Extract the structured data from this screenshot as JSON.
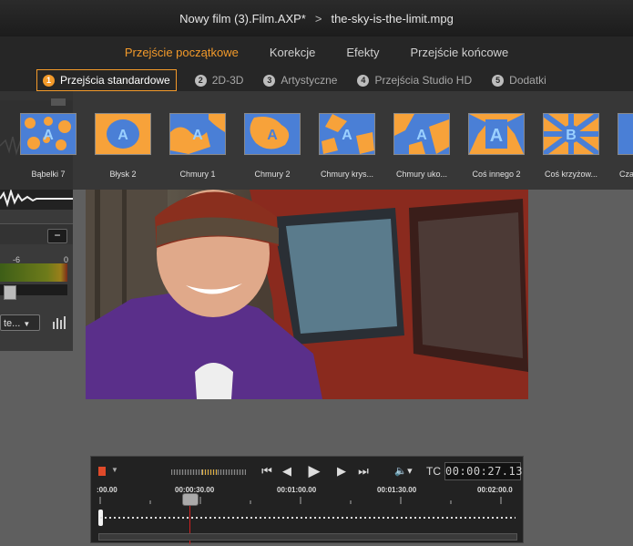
{
  "titlebar": {
    "project": "Nowy film (3).Film.AXP",
    "modified_mark": "*",
    "separator": ">",
    "clip": "the-sky-is-the-limit.mpg"
  },
  "main_tabs": [
    {
      "label": "Przejście początkowe",
      "active": true
    },
    {
      "label": "Korekcje",
      "active": false
    },
    {
      "label": "Efekty",
      "active": false
    },
    {
      "label": "Przejście końcowe",
      "active": false
    }
  ],
  "sub_tabs": [
    {
      "num": "1",
      "label": "Przejścia standardowe",
      "active": true
    },
    {
      "num": "2",
      "label": "2D-3D",
      "active": false
    },
    {
      "num": "3",
      "label": "Artystyczne",
      "active": false
    },
    {
      "num": "4",
      "label": "Przejścia Studio HD",
      "active": false
    },
    {
      "num": "5",
      "label": "Dodatki",
      "active": false
    }
  ],
  "transitions": [
    {
      "label": "Bąbelki 7"
    },
    {
      "label": "Błysk 2"
    },
    {
      "label": "Chmury 1"
    },
    {
      "label": "Chmury 2"
    },
    {
      "label": "Chmury krys..."
    },
    {
      "label": "Chmury uko..."
    },
    {
      "label": "Coś innego 2"
    },
    {
      "label": "Coś krzyżow..."
    },
    {
      "label": "Cza"
    }
  ],
  "left_panel": {
    "collapse": "−",
    "scale_left": "-6",
    "scale_right": "0",
    "dropdown_value": "te..."
  },
  "transport": {
    "tc_label": "TC",
    "timecode": "00:00:27.13",
    "ruler": [
      ":00.00",
      "00:00:30.00",
      "00:01:00.00",
      "00:01:30.00",
      "00:02:00.0"
    ]
  },
  "colors": {
    "accent": "#f39a2a",
    "thumb_blue": "#4a7fd6",
    "thumb_orange": "#f7a23a"
  }
}
